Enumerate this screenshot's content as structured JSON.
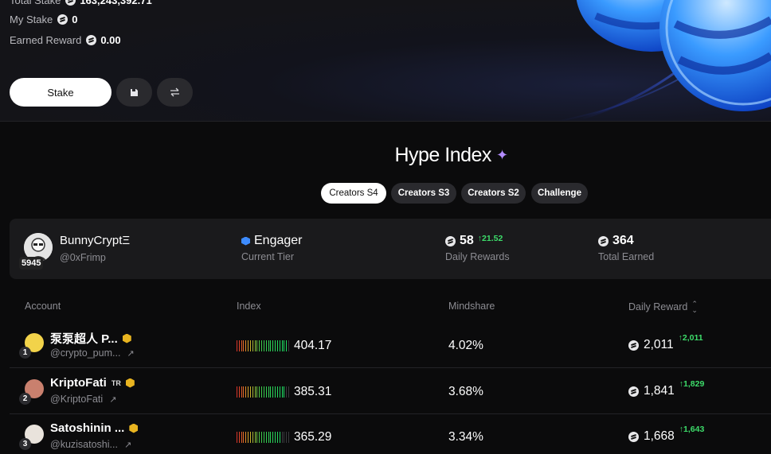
{
  "stake_panel": {
    "total_stake_label": "Total Stake",
    "total_stake_value": "163,243,392.71",
    "my_stake_label": "My Stake",
    "my_stake_value": "0",
    "earned_label": "Earned Reward",
    "earned_value": "0.00",
    "stake_button": "Stake",
    "icons": [
      "save-icon",
      "swap-icon"
    ]
  },
  "hype": {
    "title": "Hype Index",
    "tabs": [
      {
        "label": "Creators S4",
        "active": true
      },
      {
        "label": "Creators S3",
        "active": false
      },
      {
        "label": "Creators S2",
        "active": false
      },
      {
        "label": "Challenge",
        "active": false
      }
    ]
  },
  "profile": {
    "name": "BunnyCryptΞ",
    "handle": "@0xFrimp",
    "rank": "5945",
    "tier": "Engager",
    "tier_label": "Current Tier",
    "daily_rewards": "58",
    "daily_rewards_change": "21.52",
    "daily_rewards_label": "Daily Rewards",
    "total_earned": "364",
    "total_earned_label": "Total Earned"
  },
  "table": {
    "headers": {
      "account": "Account",
      "index": "Index",
      "mindshare": "Mindshare",
      "daily_reward": "Daily Reward"
    },
    "rows": [
      {
        "rank": "1",
        "name": "泵泵超人 P...",
        "tag": "",
        "handle": "@crypto_pum...",
        "index": "404.17",
        "index_level": 0.95,
        "mindshare": "4.02%",
        "reward": "2,011",
        "reward_change": "2,011",
        "avatar_color": "#f2d34a"
      },
      {
        "rank": "2",
        "name": "KriptoFati",
        "tag": "TR",
        "handle": "@KriptoFati",
        "index": "385.31",
        "index_level": 0.9,
        "mindshare": "3.68%",
        "reward": "1,841",
        "reward_change": "1,829",
        "avatar_color": "#c9806e"
      },
      {
        "rank": "3",
        "name": "Satoshinin ...",
        "tag": "",
        "handle": "@kuzisatoshi...",
        "index": "365.29",
        "index_level": 0.85,
        "mindshare": "3.34%",
        "reward": "1,668",
        "reward_change": "1,643",
        "avatar_color": "#e9e3dc"
      }
    ]
  },
  "colors": {
    "accent_green": "#3ddc6a",
    "tier_blue": "#3d8bff",
    "badge_gold": "#e8b420",
    "sparkle_purple": "#b48cff"
  }
}
